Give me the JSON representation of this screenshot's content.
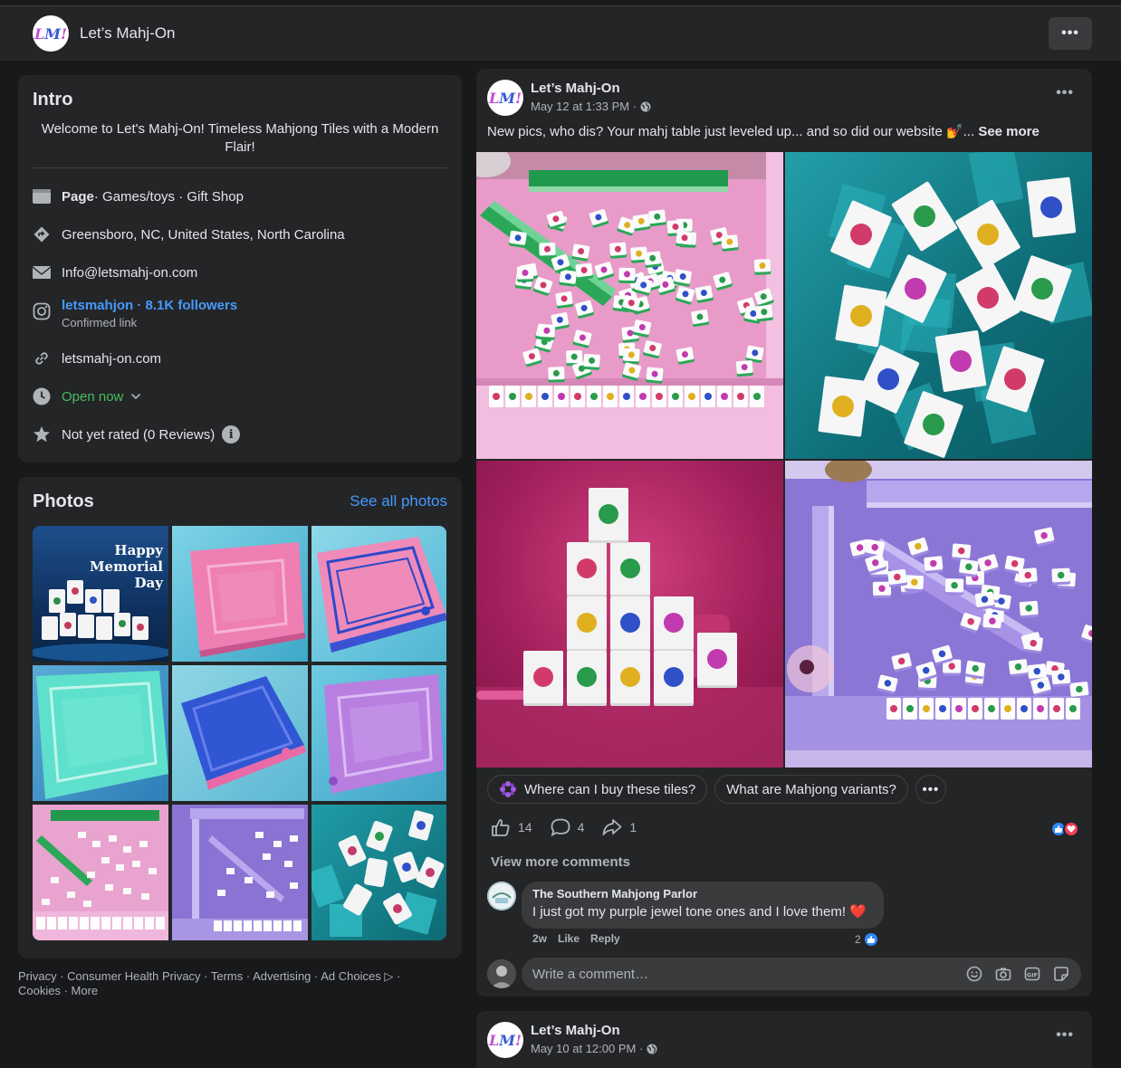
{
  "page": {
    "name": "Let’s Mahj-On",
    "logo_text": "LMO",
    "more_label": "•••"
  },
  "intro": {
    "heading": "Intro",
    "description": "Welcome to Let's Mahj-On! Timeless Mahjong Tiles with a Modern Flair!",
    "category_label": "Page",
    "category_value": " · Games/toys · Gift Shop",
    "address": "Greensboro, NC, United States, North Carolina",
    "email": "Info@letsmahj-on.com",
    "instagram": "letsmahjon · 8.1K followers",
    "instagram_sub": "Confirmed link",
    "website": "letsmahj-on.com",
    "hours": "Open now",
    "rating": "Not yet rated (0 Reviews)"
  },
  "photos": {
    "heading": "Photos",
    "see_all": "See all photos",
    "thumb1_text_1": "Happy",
    "thumb1_text_2": "Memorial",
    "thumb1_text_3": "Day"
  },
  "footer": {
    "line1": "Privacy · Consumer Health Privacy · Terms · Advertising · Ad Choices ▷ ·",
    "line2": "Cookies · More"
  },
  "post": {
    "author": "Let’s Mahj-On",
    "meta": "May 12 at 1:33 PM ·",
    "text": "New pics, who dis? Your mahj table just leveled up... and so did our website 💅... ",
    "see_more": "See more",
    "chips": [
      "Where can I buy these tiles?",
      "What are Mahjong variants?"
    ],
    "chip_more": "•••",
    "likes": "14",
    "comments": "4",
    "shares": "1",
    "view_more": "View more comments",
    "comment": {
      "name": "The Southern Mahjong Parlor",
      "text": "I just got my purple jewel tone ones and I love them! ❤️",
      "time": "2w",
      "like": "Like",
      "reply": "Reply",
      "reaction_count": "2"
    },
    "write_placeholder": "Write a comment…"
  },
  "post2": {
    "author": "Let’s Mahj-On",
    "meta": "May 10 at 12:00 PM ·"
  }
}
